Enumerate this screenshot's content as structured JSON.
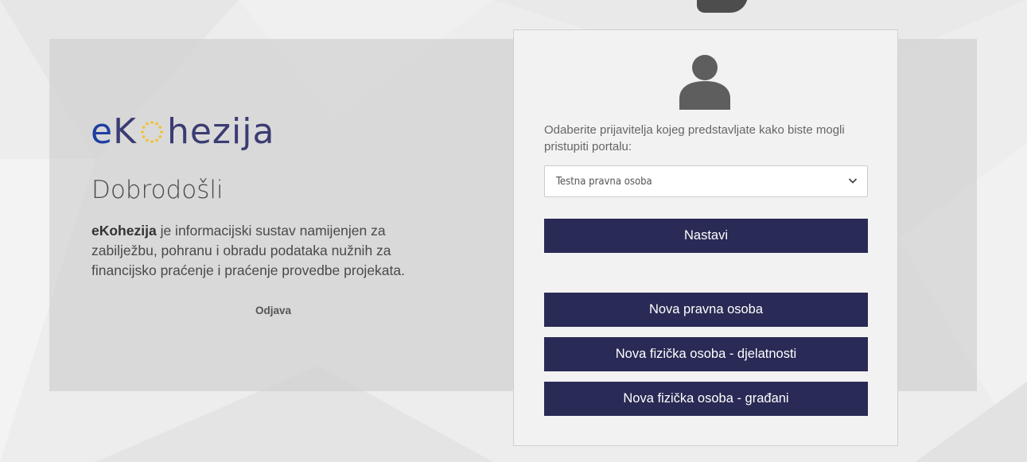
{
  "brand": {
    "logo_prefix": "eK",
    "logo_suffix": "hezija"
  },
  "intro": {
    "welcome": "Dobrodošli",
    "app_name": "eKohezija",
    "description": "je informacijski sustav namijenjen za zabilježbu, pohranu i obradu podataka nužnih za financijsko praćenje i praćenje provedbe projekata.",
    "logout_label": "Odjava"
  },
  "login": {
    "prompt": "Odaberite prijavitelja kojeg predstavljate kako biste mogli pristupiti portalu:",
    "selected_applicant": "Testna pravna osoba",
    "continue_label": "Nastavi",
    "new_legal_label": "Nova pravna osoba",
    "new_natural_business_label": "Nova fizička osoba - djelatnosti",
    "new_natural_citizens_label": "Nova fizička osoba - građani"
  },
  "colors": {
    "button_bg": "#292a55",
    "logo_e": "#1f3ea3",
    "logo_text": "#3a3c73",
    "star_gold": "#f2c230"
  },
  "icons": {
    "user": "user-silhouette-icon",
    "dropdown": "chevron-down-icon",
    "logo_mark": "eu-stars-icon"
  }
}
